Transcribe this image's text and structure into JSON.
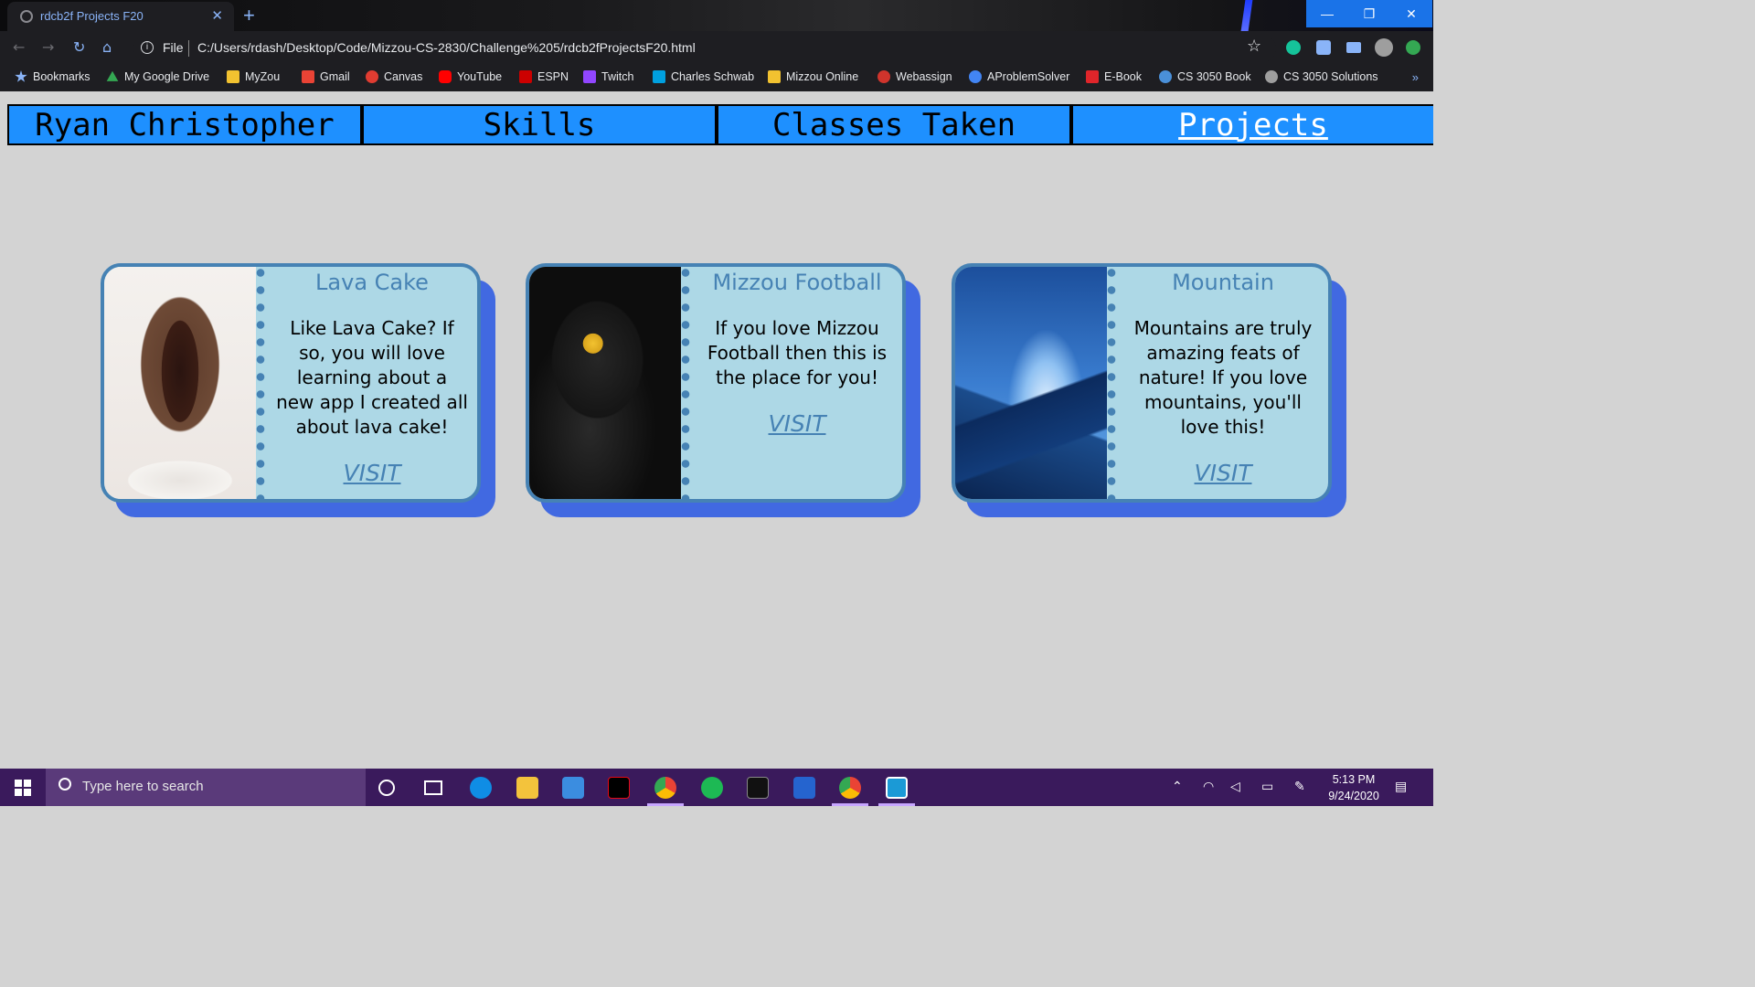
{
  "browser": {
    "tab_title": "rdcb2f Projects F20",
    "tab_close": "✕",
    "new_tab": "+",
    "file_label": "File",
    "url": "C:/Users/rdash/Desktop/Code/Mizzou-CS-2830/Challenge%205/rdcb2fProjectsF20.html",
    "window_controls": {
      "minimize": "—",
      "maximize": "❐",
      "close": "✕"
    },
    "bookmarks": [
      {
        "label": "Bookmarks",
        "color": "#8ab4f8"
      },
      {
        "label": "My Google Drive",
        "color": "#34a853"
      },
      {
        "label": "MyZou",
        "color": "#f2c230"
      },
      {
        "label": "Gmail",
        "color": "#ea4335"
      },
      {
        "label": "Canvas",
        "color": "#e03c31"
      },
      {
        "label": "YouTube",
        "color": "#ff0000"
      },
      {
        "label": "ESPN",
        "color": "#cc0000"
      },
      {
        "label": "Twitch",
        "color": "#9146ff"
      },
      {
        "label": "Charles Schwab",
        "color": "#00a0df"
      },
      {
        "label": "Mizzou Online",
        "color": "#f2c230"
      },
      {
        "label": "Webassign",
        "color": "#d0342c"
      },
      {
        "label": "AProblemSolver",
        "color": "#4285f4"
      },
      {
        "label": "E-Book",
        "color": "#e0252a"
      },
      {
        "label": "CS 3050 Book",
        "color": "#4a90d9"
      },
      {
        "label": "CS 3050 Solutions",
        "color": "#9e9e9e"
      }
    ],
    "bookmarks_more": "»"
  },
  "nav": {
    "items": [
      {
        "label": "Ryan Christopher"
      },
      {
        "label": "Skills"
      },
      {
        "label": "Classes Taken"
      },
      {
        "label": "Projects"
      }
    ]
  },
  "projects": [
    {
      "title": "Lava Cake",
      "description": "Like Lava Cake? If so, you will love learning about a new app I created all about lava cake!",
      "link": "VISIT"
    },
    {
      "title": "Mizzou Football",
      "description": "If you love Mizzou Football then this is the place for you!",
      "link": "VISIT"
    },
    {
      "title": "Mountain",
      "description": "Mountains are truly amazing feats of nature! If you love mountains, you'll love this!",
      "link": "VISIT"
    }
  ],
  "taskbar": {
    "search_placeholder": "Type here to search",
    "time": "5:13 PM",
    "date": "9/24/2020"
  },
  "colors": {
    "nav_bg": "#1e90ff",
    "card_bg": "#add8e6",
    "card_border": "#4682b4",
    "card_shadow": "#4169e1",
    "page_bg": "#d3d3d3"
  }
}
